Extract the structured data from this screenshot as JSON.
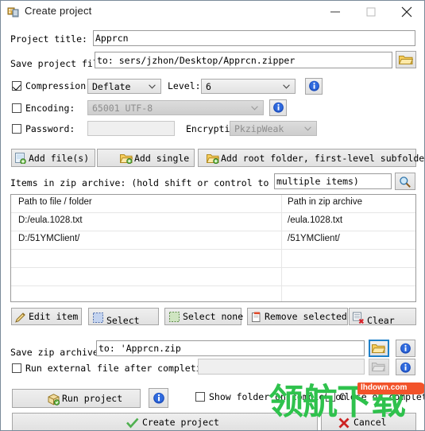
{
  "window": {
    "title": "Create project",
    "icon": "app-icon",
    "minimize": "—",
    "maximize": "□",
    "close": "✕"
  },
  "project": {
    "title_label": "Project title:",
    "title_value": "Apprcn",
    "save_label": "Save project file to:",
    "save_value": "to: sers/jzhon/Desktop/Apprcn.zipper",
    "browse_icon": "folder-icon"
  },
  "compression": {
    "checkbox_label": "Compression:",
    "checked": true,
    "method": "Deflate",
    "level_label": "Level:",
    "level": "6",
    "info_icon": "info-icon"
  },
  "encoding": {
    "checkbox_label": "Encoding:",
    "checked": false,
    "value": "65001 UTF-8",
    "info_icon": "info-icon"
  },
  "password": {
    "checkbox_label": "Password:",
    "checked": false,
    "value": "",
    "encryption_label": "Encryption:",
    "encryption_value": "PkzipWeak"
  },
  "add_buttons": [
    {
      "label": "Add file(s)",
      "icon": "add-file-icon"
    },
    {
      "label": "Add single",
      "icon": "add-folder-icon"
    },
    {
      "label": "Add root folder, first-level subfolders",
      "icon": "add-root-folder-icon"
    }
  ],
  "items": {
    "label": "Items in zip archive: (hold shift or control to select",
    "field_value": "multiple items)",
    "search_icon": "magnifier-icon",
    "columns": [
      "Path to file / folder",
      "Path in zip archive"
    ],
    "rows": [
      {
        "path": "D:/eula.1028.txt",
        "zip_path": "/eula.1028.txt"
      },
      {
        "path": "D:/51YMClient/",
        "zip_path": "/51YMClient/"
      }
    ],
    "empty_rows": 4
  },
  "item_buttons": [
    {
      "label": "Edit item",
      "icon": "pencil-icon"
    },
    {
      "label": "Select",
      "icon": "select-icon"
    },
    {
      "label": "Select none",
      "icon": "select-none-icon"
    },
    {
      "label": "Remove selected",
      "icon": "remove-icon"
    },
    {
      "label": "Clear",
      "icon": "clear-icon"
    }
  ],
  "save_archive": {
    "label": "Save zip archive to:",
    "value": "to: 'Apprcn.zip",
    "browse_icon": "folder-icon",
    "info_icon": "info-icon"
  },
  "run_external": {
    "checkbox_label": "Run external file after completion:",
    "checked": false,
    "value": "",
    "browse_icon": "folder-icon",
    "info_icon": "info-icon"
  },
  "footer": {
    "run_project": "Run project",
    "run_project_icon": "package-icon",
    "run_info_icon": "info-icon",
    "show_folder_label": "Show folder on completion",
    "show_folder_checked": false,
    "close_on_completion_label": "Close on completion",
    "close_on_completion_checked": false,
    "create_project": "Create project",
    "create_icon": "check-icon",
    "cancel": "Cancel",
    "cancel_icon": "red-x-icon"
  },
  "watermark": {
    "chinese": "领航下载",
    "site": "lhdown.com"
  },
  "colors": {
    "accent_blue": "#1e80c8",
    "info_blue": "#1d4fbe",
    "watermark_green": "#2fc24d",
    "badge_orange": "#f2532a"
  }
}
